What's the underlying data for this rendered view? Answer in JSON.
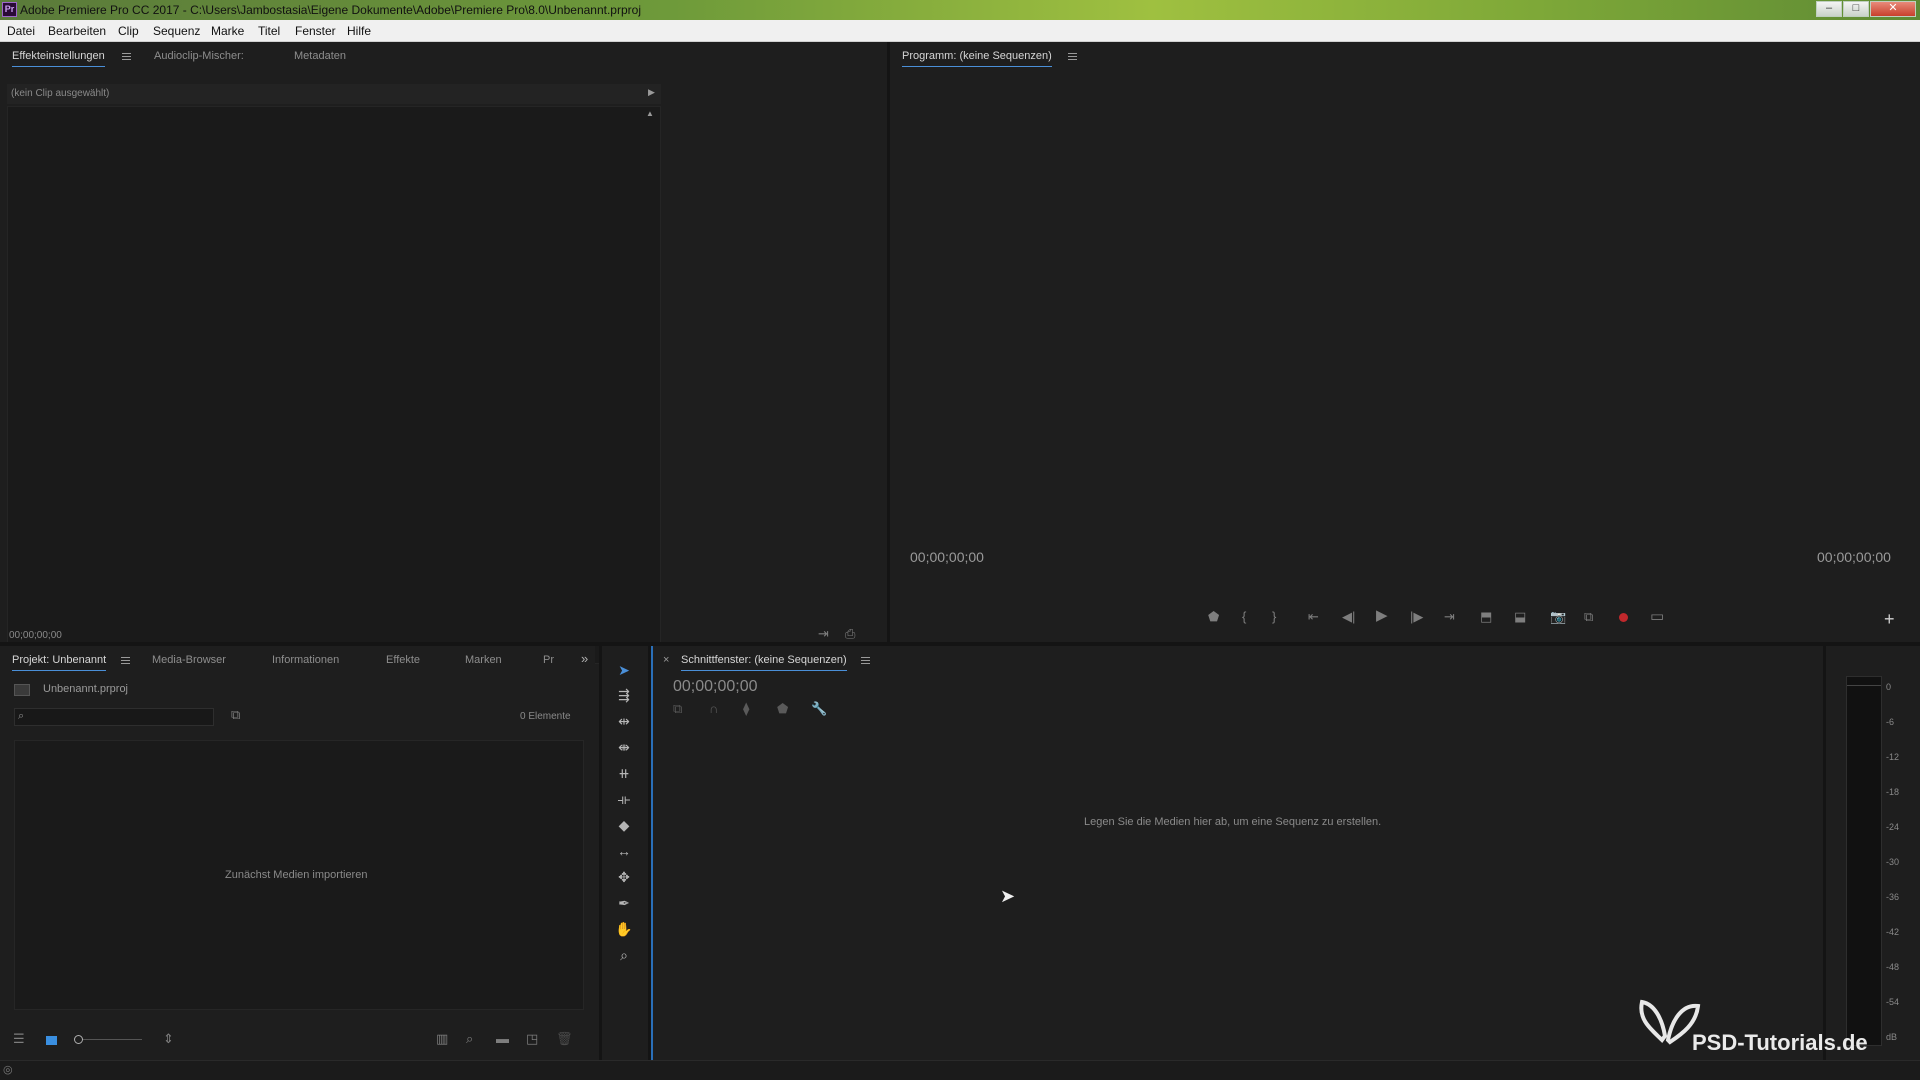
{
  "window": {
    "title": "Adobe Premiere Pro CC 2017 - C:\\Users\\Jambostasia\\Eigene Dokumente\\Adobe\\Premiere Pro\\8.0\\Unbenannt.prproj",
    "app_icon": "Pr"
  },
  "menu": [
    "Datei",
    "Bearbeiten",
    "Clip",
    "Sequenz",
    "Marke",
    "Titel",
    "Fenster",
    "Hilfe"
  ],
  "effects_panel": {
    "tabs": [
      "Effekteinstellungen",
      "Audioclip-Mischer:",
      "Metadaten"
    ],
    "no_clip": "(kein Clip ausgewählt)",
    "timecode": "00;00;00;00"
  },
  "program_monitor": {
    "title": "Programm: (keine Sequenzen)",
    "timecode_left": "00;00;00;00",
    "timecode_right": "00;00;00;00"
  },
  "project_panel": {
    "tabs": [
      "Projekt: Unbenannt",
      "Media-Browser",
      "Informationen",
      "Effekte",
      "Marken",
      "Pr"
    ],
    "file": "Unbenannt.prproj",
    "count": "0 Elemente",
    "empty_hint": "Zunächst Medien importieren"
  },
  "timeline": {
    "title": "Schnittfenster: (keine Sequenzen)",
    "close": "×",
    "timecode": "00;00;00;00",
    "drop_hint": "Legen Sie die Medien hier ab, um eine Sequenz zu erstellen."
  },
  "audio_meter": {
    "labels": [
      "0",
      "-6",
      "-12",
      "-18",
      "-24",
      "-30",
      "-36",
      "-42",
      "-48",
      "-54",
      "dB"
    ]
  },
  "watermark": "PSD-Tutorials.de",
  "colors": {
    "accent_blue": "#4a8fd8",
    "record_red": "#c0282c",
    "panel_bg": "#1e1e1e"
  }
}
